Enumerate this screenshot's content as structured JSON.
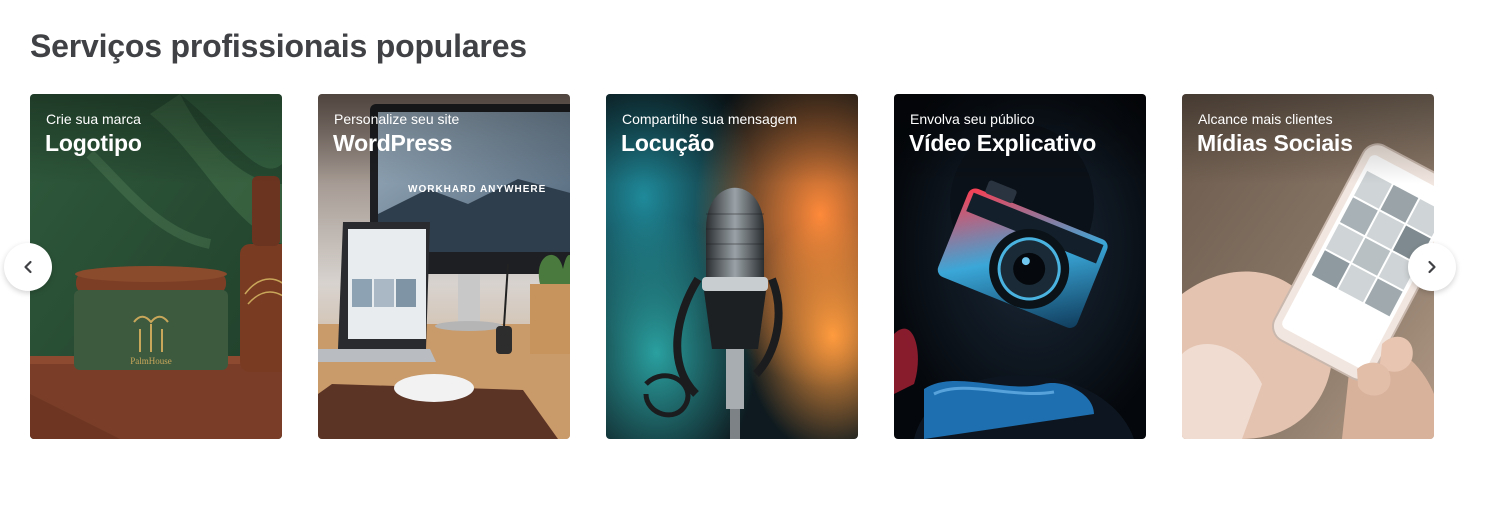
{
  "section": {
    "title": "Serviços profissionais populares"
  },
  "cards": [
    {
      "subtitle": "Crie sua marca",
      "name": "Logotipo",
      "image_label": "PalmHouse"
    },
    {
      "subtitle": "Personalize seu site",
      "name": "WordPress",
      "image_label": "WORKHARD ANYWHERE"
    },
    {
      "subtitle": "Compartilhe sua mensagem",
      "name": "Locução"
    },
    {
      "subtitle": "Envolva seu público",
      "name": "Vídeo Explicativo"
    },
    {
      "subtitle": "Alcance mais clientes",
      "name": "Mídias Sociais"
    }
  ],
  "navigation": {
    "prev_icon": "chevron-left-icon",
    "next_icon": "chevron-right-icon"
  },
  "colors": {
    "title": "#404145",
    "card_text": "#ffffff",
    "nav_bg": "#ffffff"
  }
}
